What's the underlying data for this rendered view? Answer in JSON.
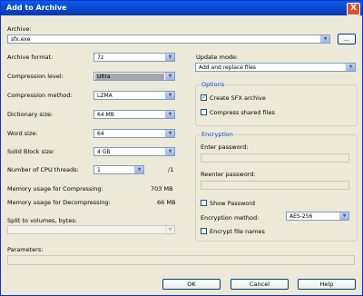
{
  "window": {
    "title": "Add to Archive",
    "close_glyph": "X"
  },
  "archive": {
    "label": "Archive:",
    "value": "sfx.exe",
    "browse_label": "..."
  },
  "left": {
    "archive_format": {
      "label": "Archive format:",
      "value": "7z"
    },
    "compression_level": {
      "label": "Compression level:",
      "value": "Ultra"
    },
    "compression_method": {
      "label": "Compression method:",
      "value": "LZMA"
    },
    "dictionary_size": {
      "label": "Dictionary size:",
      "value": "64 MB"
    },
    "word_size": {
      "label": "Word size:",
      "value": "64"
    },
    "solid_block_size": {
      "label": "Solid Block size:",
      "value": "4 GB"
    },
    "cpu_threads": {
      "label": "Number of CPU threads:",
      "value": "1",
      "max": "/1"
    },
    "memory_compress": {
      "label": "Memory usage for Compressing:",
      "value": "703 MB"
    },
    "memory_decompress": {
      "label": "Memory usage for Decompressing:",
      "value": "66 MB"
    },
    "split_volumes": {
      "label": "Split to volumes, bytes:",
      "value": ""
    },
    "parameters": {
      "label": "Parameters:",
      "value": ""
    }
  },
  "right": {
    "update_mode": {
      "label": "Update mode:",
      "value": "Add and replace files"
    },
    "options": {
      "title": "Options",
      "create_sfx": {
        "label": "Create SFX archive",
        "checked": true
      },
      "compress_shared": {
        "label": "Compress shared files",
        "checked": false
      }
    },
    "encryption": {
      "title": "Encryption",
      "enter_password": {
        "label": "Enter password:",
        "value": ""
      },
      "reenter_password": {
        "label": "Reenter password:",
        "value": ""
      },
      "show_password": {
        "label": "Show Password",
        "checked": false
      },
      "method": {
        "label": "Encryption method:",
        "value": "AES-256"
      },
      "encrypt_names": {
        "label": "Encrypt file names",
        "checked": false
      }
    }
  },
  "buttons": {
    "ok": "OK",
    "cancel": "Cancel",
    "help": "Help"
  },
  "icons": {
    "dropdown_arrow": "chevron-down-icon"
  }
}
